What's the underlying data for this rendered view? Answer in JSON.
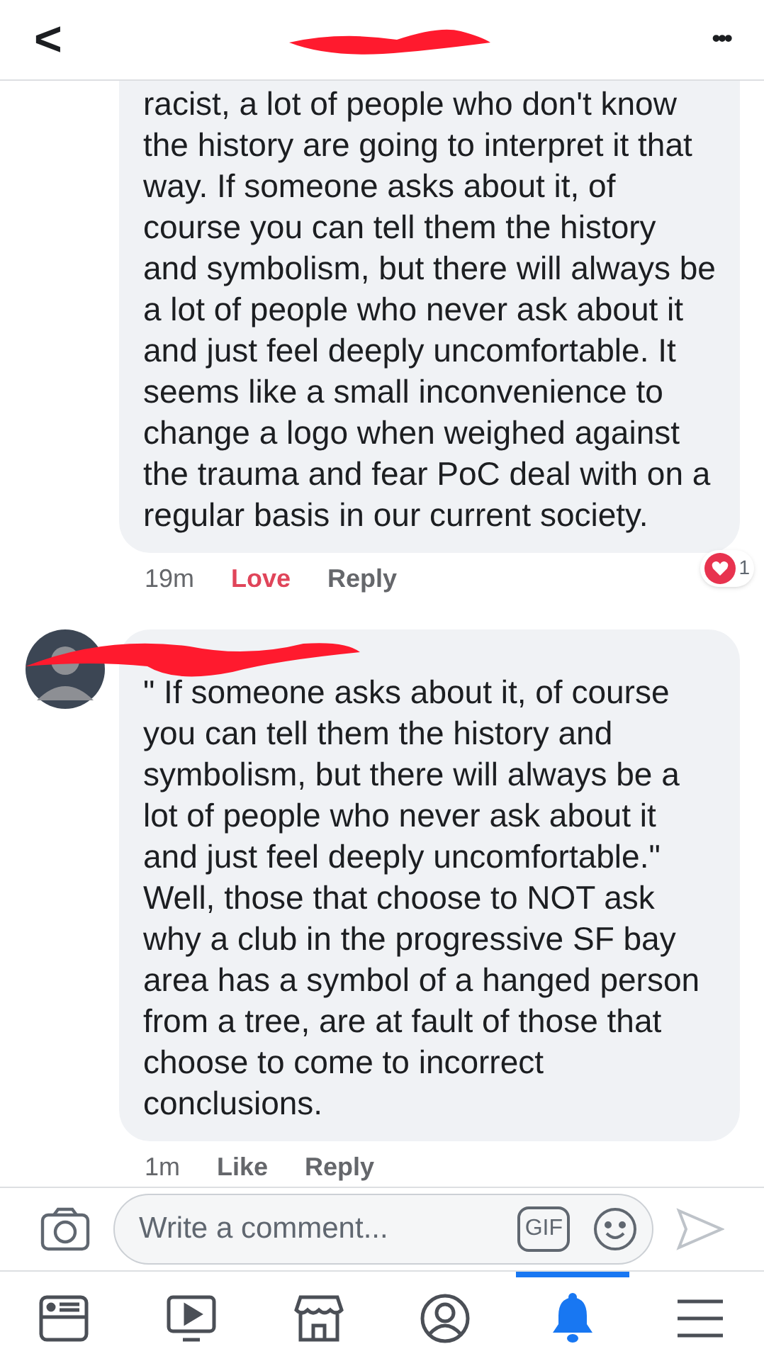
{
  "header": {
    "back": "<",
    "more": "•••"
  },
  "comments": [
    {
      "text": "racist, a lot of people who don't know the history are going to interpret it that way. If someone asks about it, of course you can tell them the history and symbolism, but there will always be a lot of people who never ask about it and just feel deeply uncomfortable. It seems like a small inconvenience to change a logo when weighed against the trauma and fear PoC deal with on a regular basis in our current society.",
      "show_author": false,
      "time": "19m",
      "reaction_action": "Love",
      "reacted": true,
      "reply": "Reply",
      "reaction_count": "1"
    },
    {
      "text": "\"  If someone asks about it, of course you can tell them the history and symbolism, but there will always be a lot of people who never ask about it and just feel deeply uncomfortable.\" Well, those that choose to NOT ask why a club in the progressive SF bay area has a symbol of a hanged person from a tree, are at fault of those that choose to come to incorrect conclusions.",
      "show_author": true,
      "time": "1m",
      "reaction_action": "Like",
      "reacted": false,
      "reply": "Reply"
    }
  ],
  "composer": {
    "placeholder": "Write a comment...",
    "gif": "GIF"
  },
  "tabs": [
    {
      "kind": "feed",
      "selected": false
    },
    {
      "kind": "video",
      "selected": false
    },
    {
      "kind": "marketplace",
      "selected": false
    },
    {
      "kind": "profile",
      "selected": false
    },
    {
      "kind": "notifications",
      "selected": true
    },
    {
      "kind": "menu",
      "selected": false
    }
  ]
}
